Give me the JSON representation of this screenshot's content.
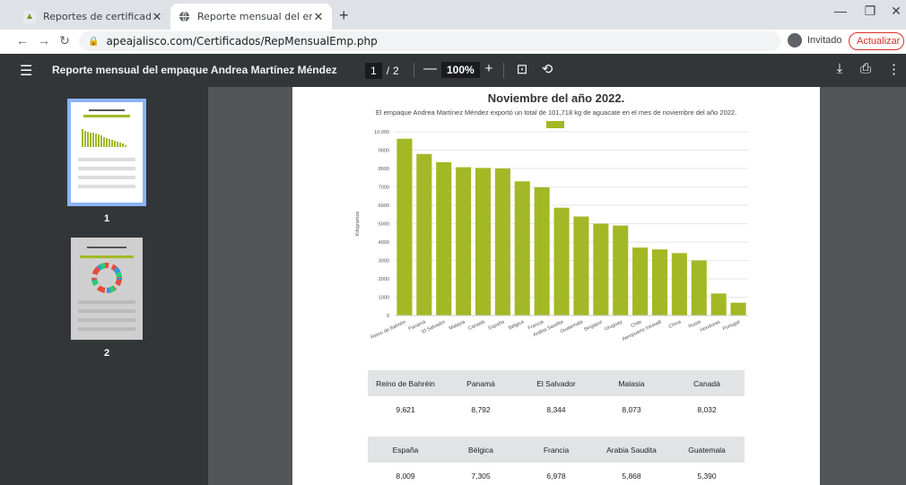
{
  "browser": {
    "tabs": [
      {
        "title": "Reportes de certificados",
        "icon": "apea-favicon-icon"
      },
      {
        "title": "Reporte mensual del empaque A",
        "icon": "globe-icon"
      }
    ],
    "new_tab": "+",
    "url": "apeajalisco.com/Certificados/RepMensualEmp.php",
    "profile_label": "Invitado",
    "update_label": "Actualizar"
  },
  "pdf_toolbar": {
    "title": "Reporte mensual del empaque Andrea Martínez Méndez",
    "current_page": "1",
    "page_sep": "/",
    "total_pages": "2",
    "zoom_out": "—",
    "zoom": "100%",
    "zoom_in": "+"
  },
  "thumbnails": [
    {
      "number": "1"
    },
    {
      "number": "2"
    }
  ],
  "report": {
    "title": "Noviembre del año 2022.",
    "subtitle": "El empaque Andrea Martínez Méndez exportó un total de 101,718 kg de aguacate en el mes de noviembre del año 2022.",
    "table": [
      {
        "headers": [
          "Reino de Bahréin",
          "Panamá",
          "El Salvador",
          "Malasia",
          "Canadá"
        ],
        "values": [
          "9,621",
          "8,792",
          "8,344",
          "8,073",
          "8,032"
        ]
      },
      {
        "headers": [
          "España",
          "Bélgica",
          "Francia",
          "Arabia Saudita",
          "Guatemala"
        ],
        "values": [
          "8,009",
          "7,305",
          "6,978",
          "5,868",
          "5,390"
        ]
      }
    ]
  },
  "chart_data": {
    "type": "bar",
    "title": "Noviembre del año 2022.",
    "ylabel": "Kilogramos",
    "xlabel": "",
    "ylim": [
      0,
      10000
    ],
    "yticks": [
      "0",
      "1000",
      "2000",
      "3000",
      "4000",
      "5000",
      "6000",
      "7000",
      "8000",
      "9000",
      "10,000"
    ],
    "categories": [
      "Reino de Bahréin",
      "Panamá",
      "El Salvador",
      "Malasia",
      "Canadá",
      "España",
      "Bélgica",
      "Francia",
      "Arabia Saudita",
      "Guatemala",
      "Singapur",
      "Uruguay",
      "Chile",
      "Aeropuerto Intuwall",
      "China",
      "Rusia",
      "Honduras",
      "Portugal"
    ],
    "values": [
      9621,
      8792,
      8344,
      8073,
      8032,
      8009,
      7305,
      6978,
      5868,
      5390,
      5000,
      4900,
      3700,
      3600,
      3400,
      3000,
      1200,
      700
    ],
    "color": "#a3b825",
    "grid": true,
    "legend": "top-center"
  }
}
